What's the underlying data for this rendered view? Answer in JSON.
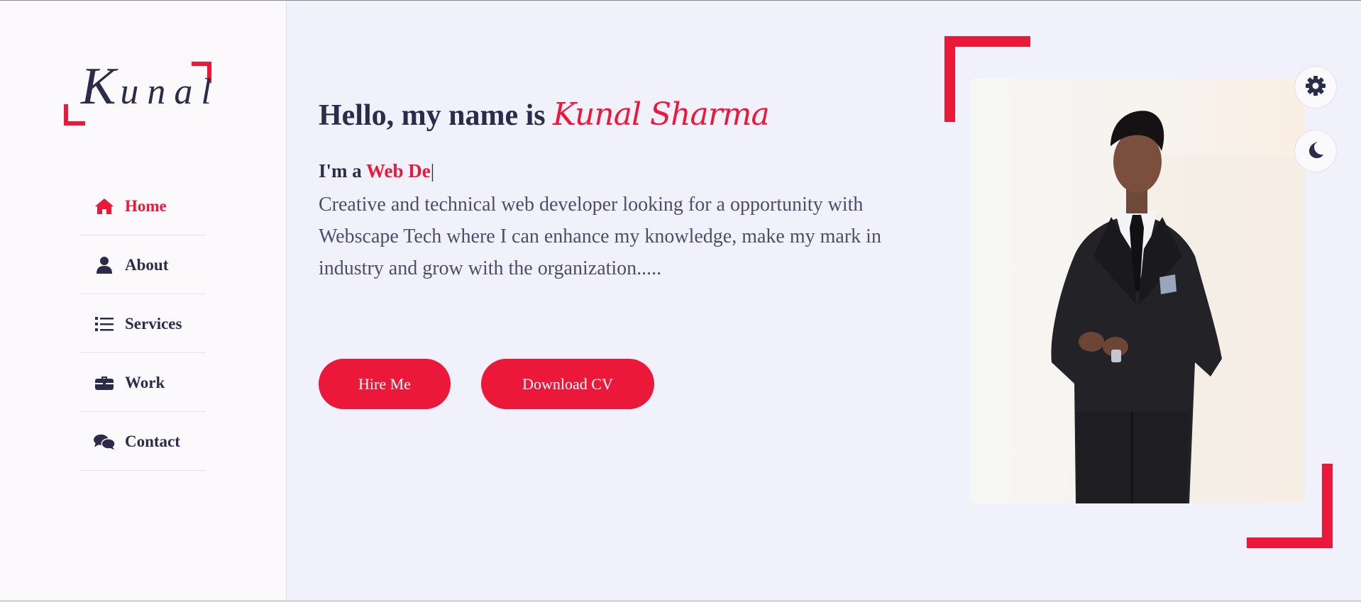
{
  "logo": {
    "first": "K",
    "rest": "unal"
  },
  "nav": {
    "items": [
      {
        "label": "Home",
        "icon": "home-icon",
        "active": true
      },
      {
        "label": "About",
        "icon": "user-icon"
      },
      {
        "label": "Services",
        "icon": "list-icon"
      },
      {
        "label": "Work",
        "icon": "briefcase-icon"
      },
      {
        "label": "Contact",
        "icon": "comments-icon"
      }
    ]
  },
  "hero": {
    "greeting": "Hello, my name is",
    "name": "Kunal Sharma",
    "role_prefix": "I'm a",
    "role_typed": "Web De",
    "cursor": "|",
    "description": "Creative and technical web developer looking for a opportunity with Webscape Tech where I can enhance my knowledge, make my mark in industry and grow with the organization.....",
    "hire_label": "Hire Me",
    "cv_label": "Download CV"
  },
  "colors": {
    "accent": "#ec1839",
    "text": "#2b2c4a",
    "bg": "#f1f1fb",
    "sidebar": "#fcf9fd"
  }
}
